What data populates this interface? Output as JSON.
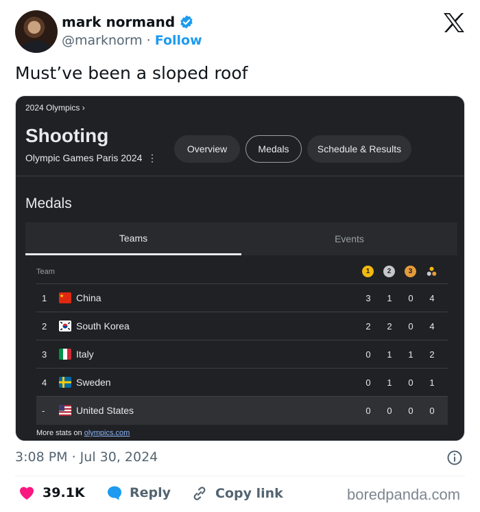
{
  "user": {
    "display_name": "mark normand",
    "handle": "@marknorm",
    "separator": "·",
    "follow_label": "Follow"
  },
  "tweet": {
    "text": "Must’ve been a sloped roof",
    "timestamp": "3:08 PM · Jul 30, 2024"
  },
  "media": {
    "breadcrumb": "2024 Olympics  ›",
    "sport": "Shooting",
    "subtitle": "Olympic Games Paris 2024",
    "kebab": "⋮",
    "chips": [
      "Overview",
      "Medals",
      "Schedule & Results"
    ],
    "active_chip": "Medals",
    "section_title": "Medals",
    "subtabs": [
      "Teams",
      "Events"
    ],
    "team_header": "Team",
    "medal_headers": [
      {
        "label": "1",
        "color": "#f2b90f"
      },
      {
        "label": "2",
        "color": "#c4c7cc"
      },
      {
        "label": "3",
        "color": "#e59b3c"
      }
    ],
    "rows": [
      {
        "rank": "1",
        "country": "China",
        "gold": "3",
        "silver": "1",
        "bronze": "0",
        "total": "4"
      },
      {
        "rank": "2",
        "country": "South Korea",
        "gold": "2",
        "silver": "2",
        "bronze": "0",
        "total": "4"
      },
      {
        "rank": "3",
        "country": "Italy",
        "gold": "0",
        "silver": "1",
        "bronze": "1",
        "total": "2"
      },
      {
        "rank": "4",
        "country": "Sweden",
        "gold": "0",
        "silver": "1",
        "bronze": "0",
        "total": "1"
      },
      {
        "rank": "-",
        "country": "United States",
        "gold": "0",
        "silver": "0",
        "bronze": "0",
        "total": "0"
      }
    ],
    "more_prefix": "More stats on ",
    "more_link": "olympics.com"
  },
  "actions": {
    "likes": "39.1K",
    "reply_label": "Reply",
    "copy_label": "Copy link"
  },
  "watermark": "boredpanda.com",
  "colors": {
    "accent": "#1d9bf0",
    "like": "#f91880",
    "panel_bg": "#202124"
  }
}
